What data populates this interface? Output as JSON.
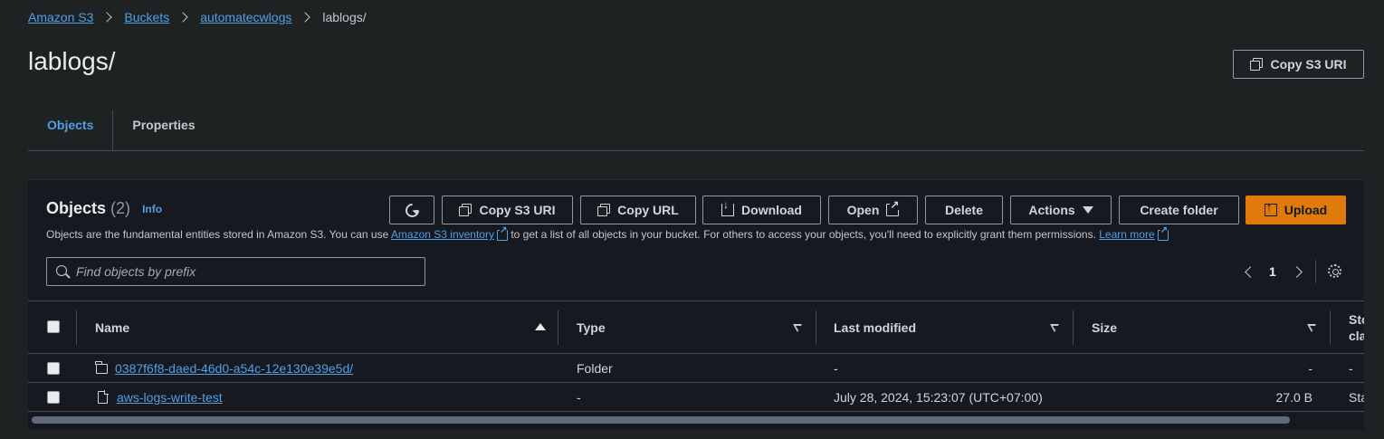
{
  "breadcrumb": {
    "items": [
      "Amazon S3",
      "Buckets",
      "automatecwlogs"
    ],
    "current": "lablogs/"
  },
  "header": {
    "title": "lablogs/",
    "copy_uri_label": "Copy S3 URI"
  },
  "tabs": [
    {
      "label": "Objects",
      "active": true
    },
    {
      "label": "Properties",
      "active": false
    }
  ],
  "objects_panel": {
    "title": "Objects",
    "count": "(2)",
    "info_label": "Info",
    "description_pre": "Objects are the fundamental entities stored in Amazon S3. You can use ",
    "inventory_link": "Amazon S3 inventory",
    "description_mid": " to get a list of all objects in your bucket. For others to access your objects, you'll need to explicitly grant them permissions. ",
    "learn_more_link": "Learn more",
    "toolbar": {
      "copy_uri": "Copy S3 URI",
      "copy_url": "Copy URL",
      "download": "Download",
      "open": "Open",
      "delete": "Delete",
      "actions": "Actions",
      "create_folder": "Create folder",
      "upload": "Upload"
    },
    "search": {
      "placeholder": "Find objects by prefix",
      "value": ""
    },
    "pagination": {
      "page": "1"
    },
    "columns": [
      "Name",
      "Type",
      "Last modified",
      "Size",
      "Sto cla"
    ],
    "column_storage_line1": "Sto",
    "column_storage_line2": "cla",
    "rows": [
      {
        "name": "0387f6f8-daed-46d0-a54c-12e130e39e5d/",
        "type": "Folder",
        "last_modified": "-",
        "size": "-",
        "storage": "-",
        "icon": "folder-icon"
      },
      {
        "name": "aws-logs-write-test",
        "type": "-",
        "last_modified": "July 28, 2024, 15:23:07 (UTC+07:00)",
        "size": "27.0 B",
        "storage": "Sta",
        "icon": "file-icon"
      }
    ]
  },
  "colors": {
    "background": "#1e2223",
    "panel": "#16191f",
    "link": "#539fe5",
    "primary_button": "#e07b0b"
  }
}
